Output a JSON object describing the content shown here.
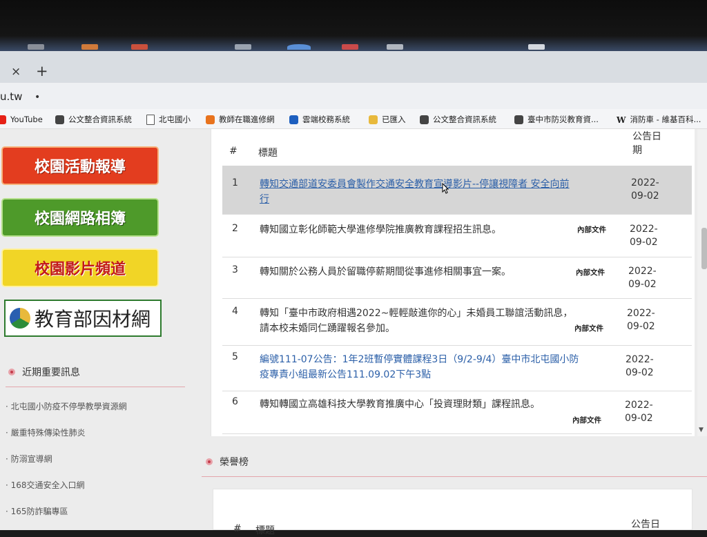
{
  "browser": {
    "tab_close": "×",
    "new_tab": "+",
    "url": "u.tw",
    "url_dot": "•",
    "bookmarks": [
      {
        "label": "YouTube",
        "icon": "youtube-icon"
      },
      {
        "label": "公文整合資訊系統",
        "icon": "globe-icon"
      },
      {
        "label": "北屯國小",
        "icon": "document-icon"
      },
      {
        "label": "教師在職進修網",
        "icon": "orange-app-icon"
      },
      {
        "label": "雲端校務系統",
        "icon": "cloud-icon"
      },
      {
        "label": "已匯入",
        "icon": "folder-icon"
      },
      {
        "label": "公文整合資訊系統",
        "icon": "globe-icon"
      },
      {
        "label": "臺中市防災教育資...",
        "icon": "globe-icon"
      },
      {
        "label": "消防車 - 維基百科...",
        "icon": "wikipedia-icon",
        "glyph": "W"
      }
    ]
  },
  "sidebar": {
    "banners": [
      "校園活動報導",
      "校園網路相簿",
      "校園影片頻道",
      "教育部因材網"
    ],
    "section_title": "近期重要訊息",
    "links": [
      "北屯國小防疫不停學教學資源網",
      "嚴重特殊傳染性肺炎",
      "防溺宣導網",
      "168交通安全入口網",
      "165防詐騙專區"
    ],
    "bullet": "·"
  },
  "announcements": {
    "headers": {
      "num": "#",
      "title": "標題",
      "date": "公告日期",
      "date_line1": "公告日",
      "date_line2": "期"
    },
    "rows": [
      {
        "num": "1",
        "title_lines": [
          "轉知交通部道安委員會製作交通安全教育宣導影片--停讓視障者 安全向前",
          "行"
        ],
        "badge": "",
        "date_lines": [
          "2022-",
          "09-02"
        ]
      },
      {
        "num": "2",
        "title_lines": [
          "轉知國立彰化師範大學進修學院推廣教育課程招生訊息。"
        ],
        "badge": "內部文件",
        "date_lines": [
          "2022-",
          "09-02"
        ]
      },
      {
        "num": "3",
        "title_lines": [
          "轉知關於公務人員於留職停薪期間從事進修相關事宜一案。"
        ],
        "badge": "內部文件",
        "date_lines": [
          "2022-",
          "09-02"
        ]
      },
      {
        "num": "4",
        "title_lines": [
          "轉知「臺中市政府相遇2022~輕輕敲進你的心」未婚員工聯誼活動訊息，",
          "請本校未婚同仁踴躍報名參加。"
        ],
        "badge": "內部文件",
        "date_lines": [
          "2022-",
          "09-02"
        ]
      },
      {
        "num": "5",
        "title_lines": [
          "編號111-07公告：1年2班暫停實體課程3日（9/2-9/4）臺中市北屯國小防",
          "疫專責小組最新公告111.09.02下午3點"
        ],
        "badge": "",
        "date_lines": [
          "2022-",
          "09-02"
        ]
      },
      {
        "num": "6",
        "title_lines": [
          "轉知轉國立高雄科技大學教育推廣中心「投資理財類」課程訊息。"
        ],
        "badge": "內部文件",
        "date_lines": [
          "2022-",
          "09-02"
        ]
      }
    ]
  },
  "honor": {
    "section_title": "榮譽榜",
    "headers": {
      "num": "#",
      "title": "標題",
      "date_line1": "公告日"
    }
  },
  "colors": {
    "link_blue": "#2b5fa8",
    "banner_red": "#e33d1f",
    "banner_green": "#4e9a2a",
    "banner_yellow": "#f1d526",
    "section_accent": "#c43b4a"
  }
}
